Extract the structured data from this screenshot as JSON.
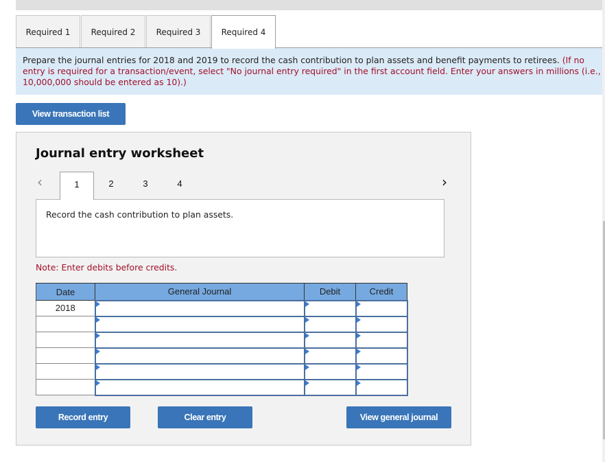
{
  "required_tabs": [
    {
      "label": "Required 1",
      "active": false
    },
    {
      "label": "Required 2",
      "active": false
    },
    {
      "label": "Required 3",
      "active": false
    },
    {
      "label": "Required 4",
      "active": true
    }
  ],
  "instructions": {
    "line1_black": "Prepare the journal entries for 2018 and 2019 to record the cash contribution to plan assets and benefit payments to retirees. ",
    "line1_red": "(If no",
    "line2_red": "entry is required for a transaction/event, select \"No journal entry required\" in the first account field. Enter your answers in millions (i.e.,",
    "line3_red": "10,000,000 should be entered as 10).)"
  },
  "buttons": {
    "view_transaction_list": "View transaction list",
    "record_entry": "Record entry",
    "clear_entry": "Clear entry",
    "view_general_journal": "View general journal"
  },
  "worksheet": {
    "title": "Journal entry worksheet",
    "prev_icon": "‹",
    "next_icon": "›",
    "tabs": [
      "1",
      "2",
      "3",
      "4"
    ],
    "active_tab": "1",
    "description": "Record the cash contribution to plan assets.",
    "note": "Note: Enter debits before credits.",
    "table": {
      "headers": {
        "date": "Date",
        "general_journal": "General Journal",
        "debit": "Debit",
        "credit": "Credit"
      },
      "rows": [
        {
          "date": "2018",
          "account": "",
          "debit": "",
          "credit": ""
        },
        {
          "date": "",
          "account": "",
          "debit": "",
          "credit": ""
        },
        {
          "date": "",
          "account": "",
          "debit": "",
          "credit": ""
        },
        {
          "date": "",
          "account": "",
          "debit": "",
          "credit": ""
        },
        {
          "date": "",
          "account": "",
          "debit": "",
          "credit": ""
        },
        {
          "date": "",
          "account": "",
          "debit": "",
          "credit": ""
        }
      ]
    }
  }
}
